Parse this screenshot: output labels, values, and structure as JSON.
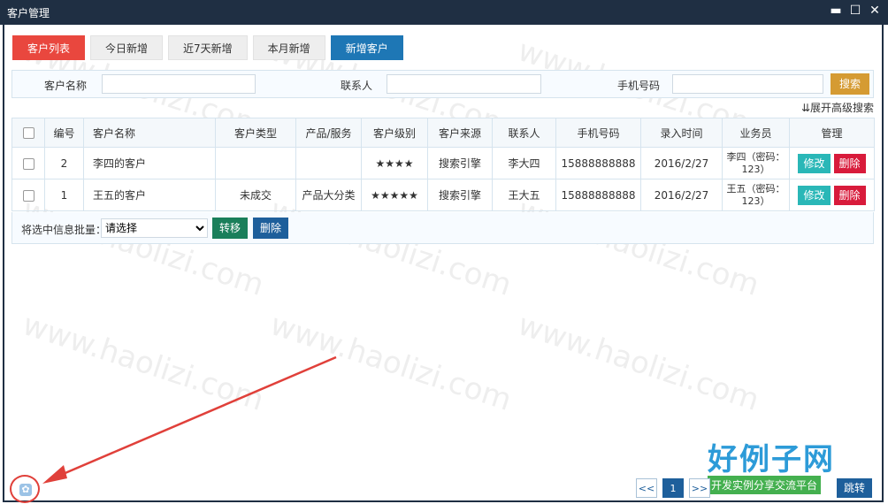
{
  "window": {
    "title": "客户管理"
  },
  "tabs": [
    {
      "label": "客户列表",
      "style": "active"
    },
    {
      "label": "今日新增",
      "style": "default"
    },
    {
      "label": "近7天新增",
      "style": "default"
    },
    {
      "label": "本月新增",
      "style": "default"
    },
    {
      "label": "新增客户",
      "style": "primary"
    }
  ],
  "search": {
    "customer_name_label": "客户名称",
    "contact_label": "联系人",
    "phone_label": "手机号码",
    "button": "搜索",
    "advanced": "⇊展开高级搜索"
  },
  "table": {
    "headers": [
      "编号",
      "客户名称",
      "客户类型",
      "产品/服务",
      "客户级别",
      "客户来源",
      "联系人",
      "手机号码",
      "录入时间",
      "业务员",
      "管理"
    ],
    "rows": [
      {
        "id": "2",
        "name": "李四的客户",
        "type": "",
        "product": "",
        "level": "★★★★",
        "source": "搜索引擎",
        "contact": "李大四",
        "phone": "15888888888",
        "date": "2016/2/27",
        "rep": "李四（密码：123）",
        "edit": "修改",
        "delete": "删除"
      },
      {
        "id": "1",
        "name": "王五的客户",
        "type": "未成交",
        "product": "产品大分类",
        "level": "★★★★★",
        "source": "搜索引擎",
        "contact": "王大五",
        "phone": "15888888888",
        "date": "2016/2/27",
        "rep": "王五（密码：123）",
        "edit": "修改",
        "delete": "删除"
      }
    ]
  },
  "batch": {
    "label": "将选中信息批量：",
    "select_value": "请选择",
    "move": "转移",
    "delete": "删除"
  },
  "pager": {
    "prev": "<<",
    "current": "1",
    "next": ">>",
    "goto": "跳转"
  },
  "brand": {
    "title": "好例子网",
    "tagline": "开发实例分享交流平台"
  },
  "watermark": "www.haolizi.com",
  "colors": {
    "titlebar": "#1f2f43",
    "active_tab": "#e9473e",
    "primary": "#1e77b5",
    "search_button": "#d59b33",
    "edit": "#2ab7b7",
    "delete": "#d81b3b"
  }
}
